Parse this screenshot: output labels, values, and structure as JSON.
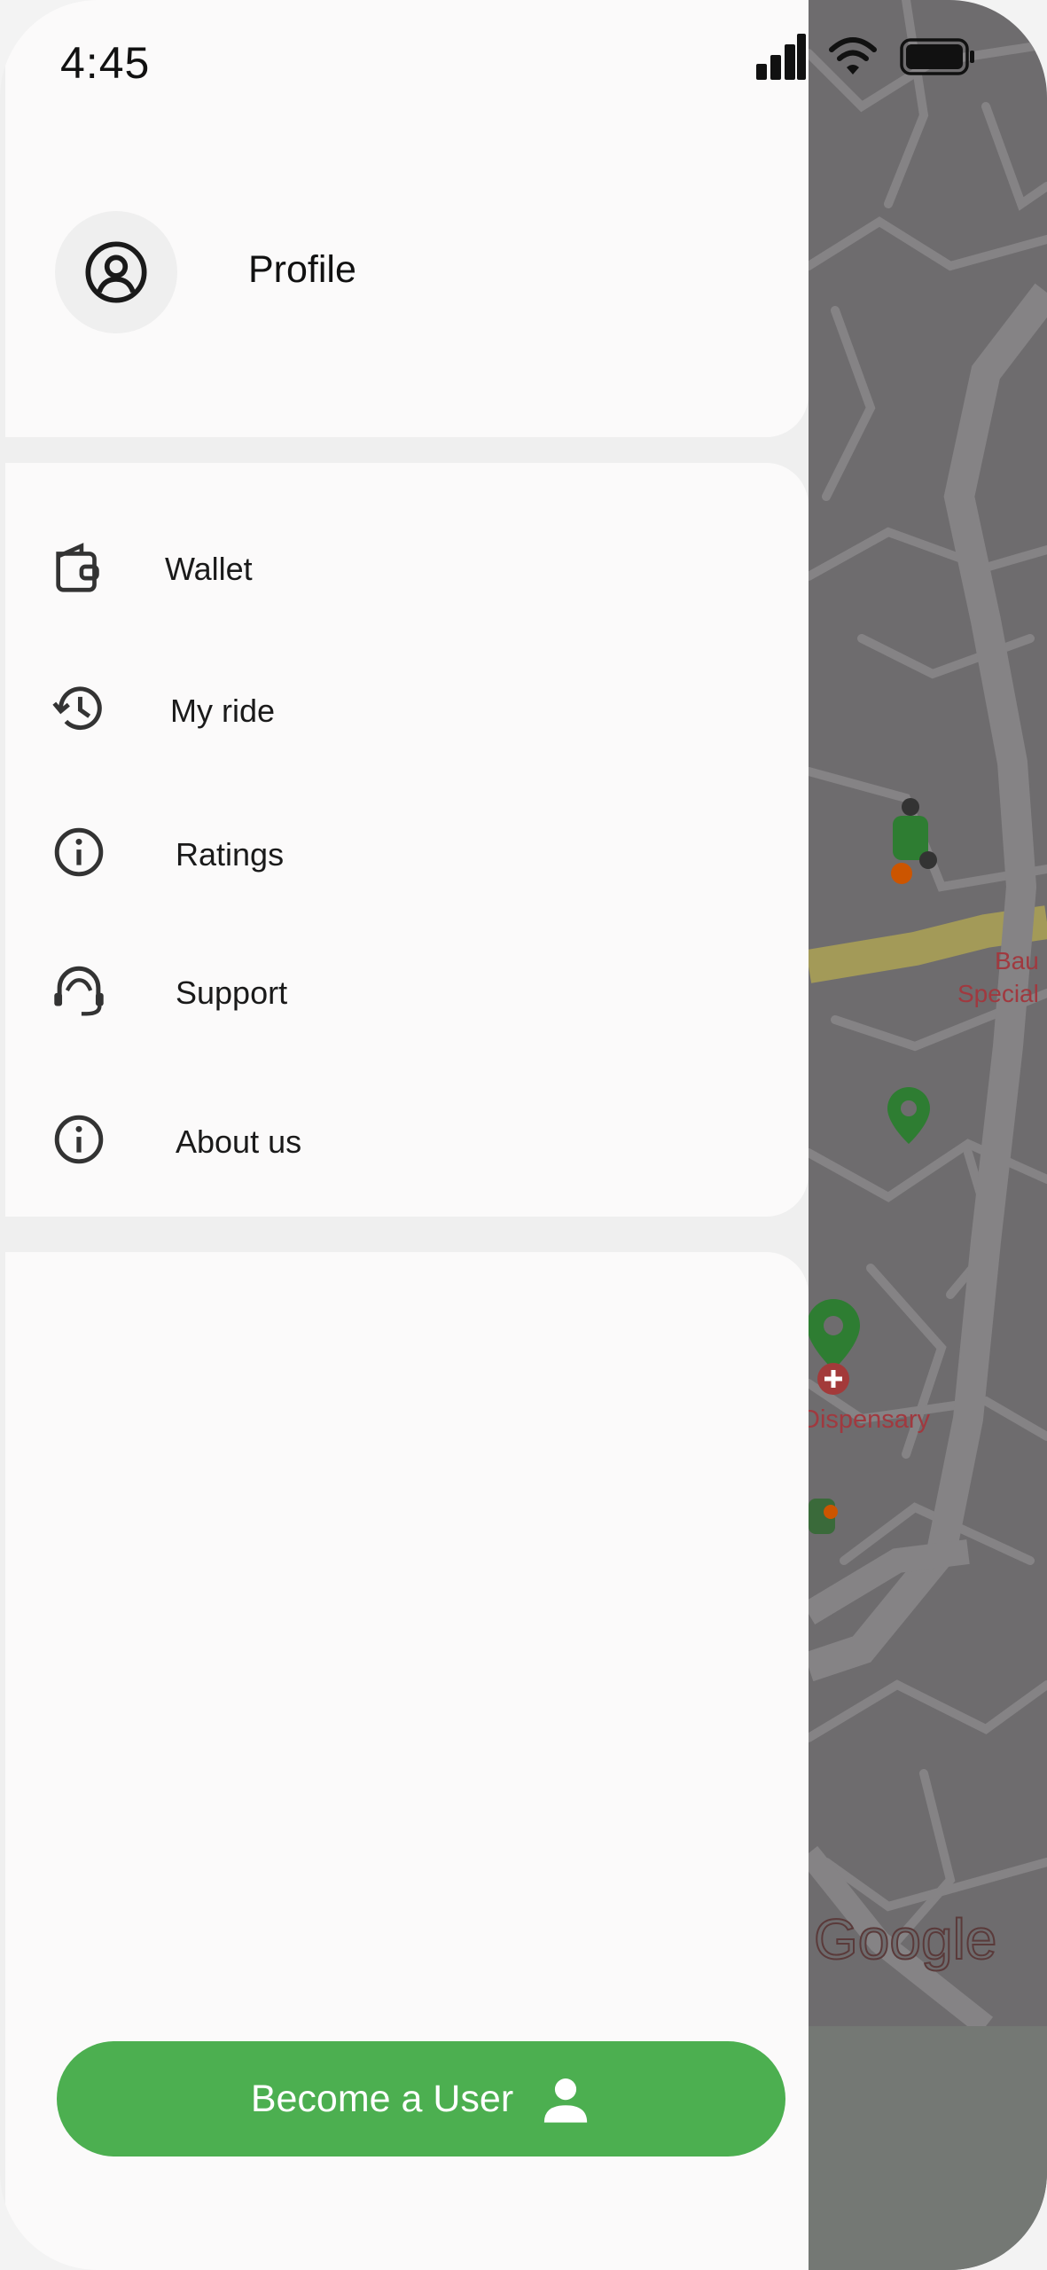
{
  "status_bar": {
    "time": "4:45",
    "icons": [
      "signal-icon",
      "wifi-icon",
      "battery-icon"
    ]
  },
  "profile": {
    "label": "Profile",
    "icon": "user-circle-icon"
  },
  "menu": {
    "items": [
      {
        "label": "Wallet",
        "icon": "wallet-icon"
      },
      {
        "label": "My ride",
        "icon": "history-icon"
      },
      {
        "label": "Ratings",
        "icon": "info-icon"
      },
      {
        "label": "Support",
        "icon": "headset-icon"
      },
      {
        "label": "About us",
        "icon": "info-icon"
      }
    ]
  },
  "cta": {
    "label": "Become a User",
    "icon": "person-icon",
    "color": "#4caf50"
  },
  "map": {
    "labels": [
      "Bau",
      "Special",
      "Dispensary"
    ],
    "attribution": "Google"
  }
}
